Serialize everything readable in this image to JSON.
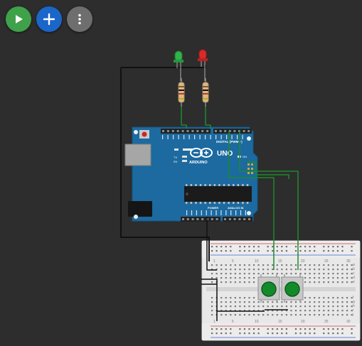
{
  "toolbar": {
    "buttons": [
      {
        "icon": "play-icon",
        "color": "#3fa14a"
      },
      {
        "icon": "plus-icon",
        "color": "#1a66c9"
      },
      {
        "icon": "more-vertical-icon",
        "color": "#6e6e6e"
      }
    ]
  },
  "arduino": {
    "model_label": "UNO",
    "brand_label": "ARDUINO",
    "on_label": "ON",
    "digital_header_label": "DIGITAL (PWM ~)",
    "power_label": "POWER",
    "analog_label": "ANALOG IN",
    "led_labels": [
      "L",
      "TX",
      "RX"
    ],
    "board_color": "#1c6aa0"
  },
  "breadboard": {
    "top_numbers": [
      "1",
      "5",
      "10",
      "15",
      "20",
      "25",
      "30"
    ],
    "bottom_numbers": [
      "1",
      "5",
      "10",
      "15",
      "20",
      "25",
      "30"
    ],
    "row_letters_top": [
      "a",
      "b",
      "c",
      "d",
      "e"
    ],
    "row_letters_bottom": [
      "f",
      "g",
      "h",
      "i",
      "j"
    ]
  },
  "components": {
    "leds": [
      {
        "color": "#2fb34a",
        "name": "green"
      },
      {
        "color": "#d92a2a",
        "name": "red"
      }
    ],
    "buttons": [
      {
        "cap_color": "#138a2a"
      },
      {
        "cap_color": "#138a2a"
      }
    ]
  },
  "wire_colors": {
    "ground": "#111111",
    "signal": "#1f8a2e"
  }
}
